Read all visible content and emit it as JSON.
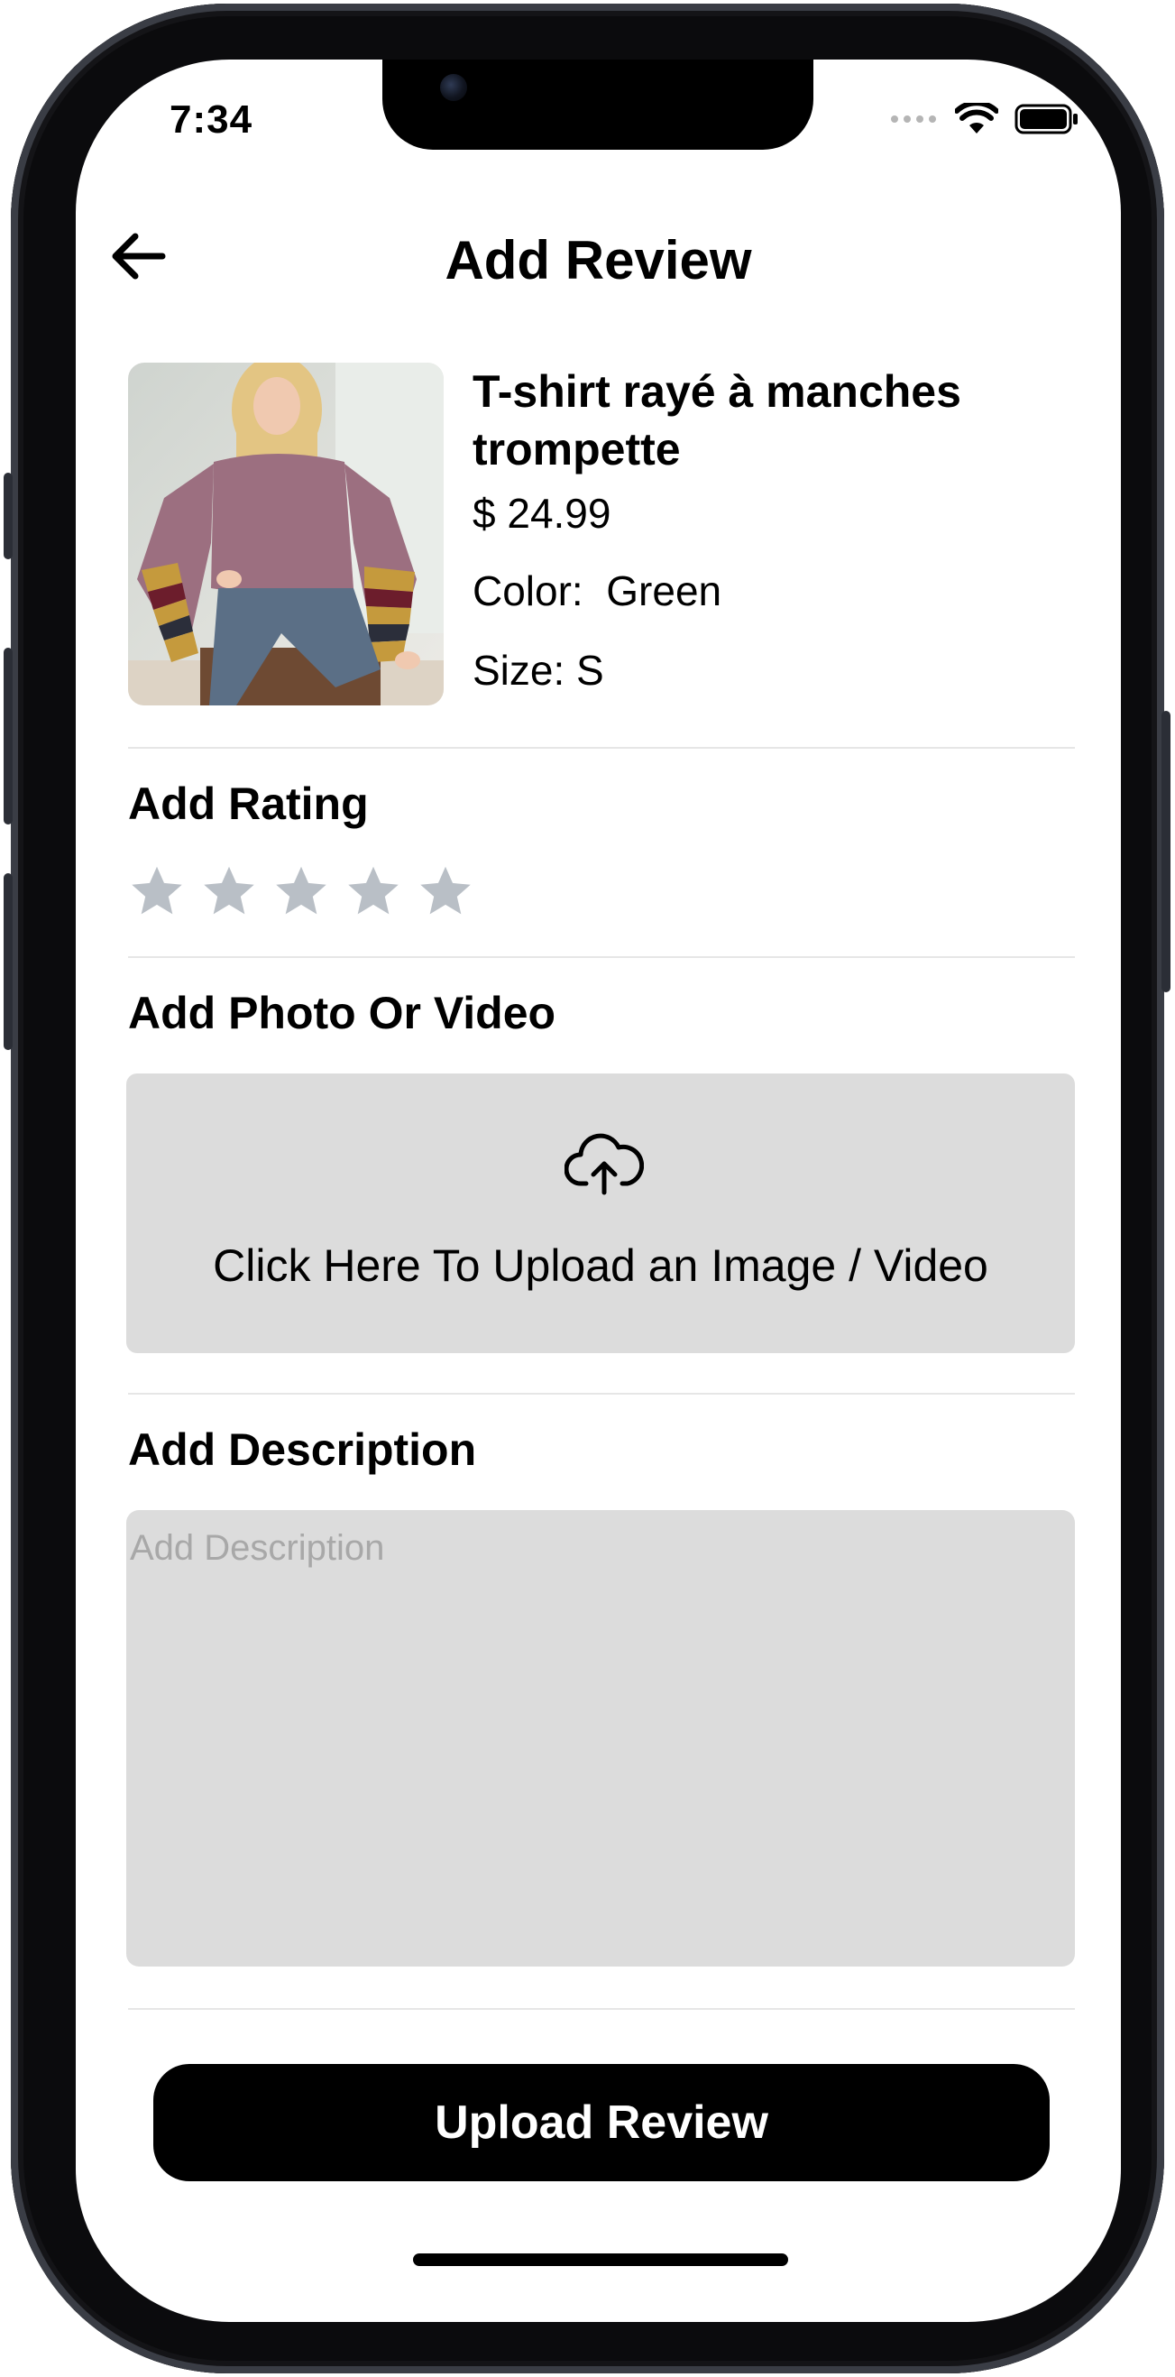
{
  "status_bar": {
    "time": "7:34"
  },
  "header": {
    "title": "Add Review"
  },
  "product": {
    "name": "T-shirt rayé à manches trompette",
    "price": "$ 24.99",
    "color_label": "Color:",
    "color_value": "Green",
    "size_label": "Size:",
    "size_value": "S"
  },
  "rating": {
    "label": "Add Rating",
    "max_stars": 5,
    "value": 0,
    "star_color": "#b9bfc6"
  },
  "media": {
    "label": "Add Photo Or Video",
    "upload_text": "Click Here To Upload an Image / Video"
  },
  "description": {
    "label": "Add Description",
    "placeholder": "Add Description",
    "value": ""
  },
  "submit": {
    "label": "Upload Review"
  },
  "colors": {
    "accent": "#000000",
    "box_background": "#dcdcdc",
    "divider": "#e6e6e6"
  }
}
